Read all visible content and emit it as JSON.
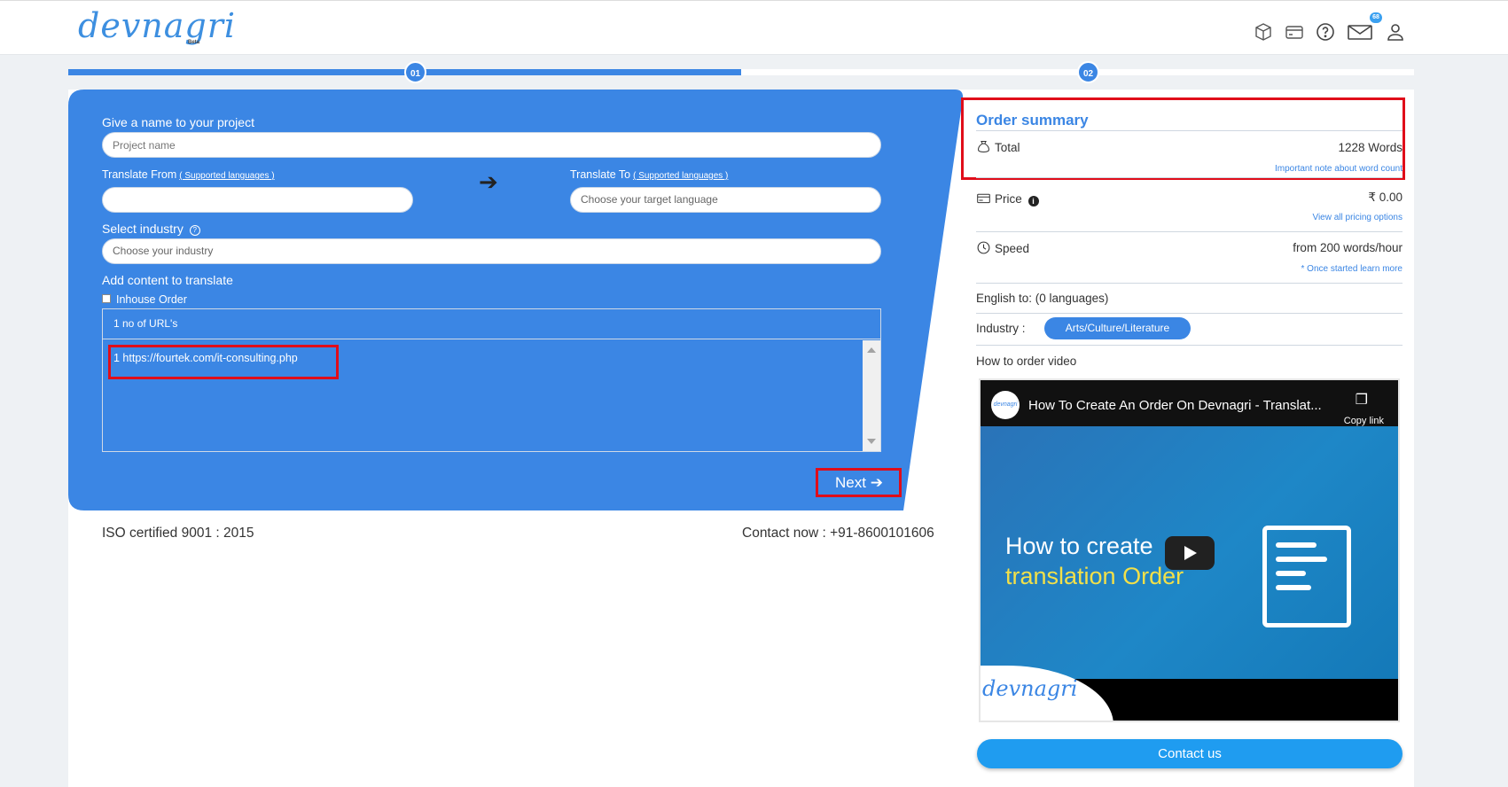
{
  "header": {
    "logo_text": "devnagri",
    "logo_badge": "Beta",
    "mail_badge": "68",
    "icons": [
      "cube-icon",
      "card-icon",
      "help-icon",
      "mail-icon",
      "user-icon"
    ]
  },
  "steps": {
    "step1": "01",
    "step2": "02",
    "progress_fraction": 0.5
  },
  "form": {
    "project_label": "Give a name to your project",
    "project_placeholder": "Project name",
    "from_label": "Translate From",
    "from_link": "( Supported languages )",
    "from_value": "",
    "to_label": "Translate To",
    "to_link": "( Supported languages )",
    "to_placeholder": "Choose your target language",
    "industry_label": "Select industry",
    "industry_placeholder": "Choose your industry",
    "content_label": "Add content to translate",
    "inhouse_label": "Inhouse Order",
    "tab_label": "1 no of URL's",
    "url_line": "1 https://fourtek.com/it-consulting.php",
    "next_label": "Next"
  },
  "footer": {
    "iso": "ISO certified 9001 : 2015",
    "contact": "Contact now : +91-8600101606"
  },
  "order_summary": {
    "title": "Order summary",
    "total_label": "Total",
    "total_value": "1228 Words",
    "total_note": "Important note about word count",
    "price_label": "Price",
    "price_value": "₹ 0.00",
    "price_note": "View all pricing options",
    "speed_label": "Speed",
    "speed_value": "from 200 words/hour",
    "speed_note": "* Once started learn more",
    "languages_line": "English to: (0 languages)",
    "industry_label": "Industry :",
    "industry_value": "Arts/Culture/Literature",
    "video_label": "How to order video",
    "contact_button": "Contact us"
  },
  "video": {
    "channel_avatar": "devnagri",
    "title": "How To Create An Order On Devnagri - Translat...",
    "copy_link": "Copy link",
    "headline1": "How to create",
    "headline2": "translation Order",
    "watermark": "devnagri"
  },
  "colors": {
    "primary": "#3b86e4",
    "highlight": "#e00d1a",
    "contact_button": "#1f9cf0"
  }
}
